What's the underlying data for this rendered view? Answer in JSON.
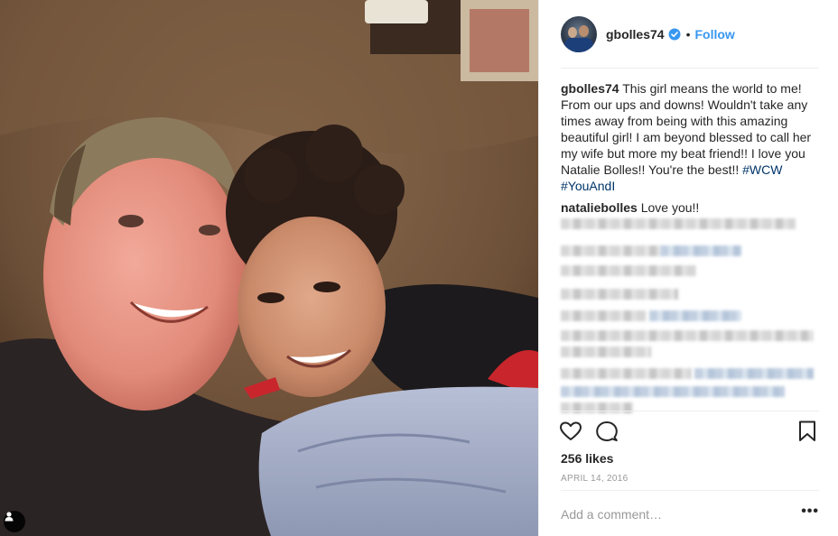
{
  "post": {
    "username": "gbolles74",
    "verified": true,
    "follow_label": "Follow",
    "separator": "•",
    "caption_user": "gbolles74",
    "caption_text": "This girl means the world to me! From our ups and downs! Wouldn't take any times away from being with this amazing beautiful girl! I am beyond blessed to call her my wife but more my beat friend!! I love you Natalie Bolles!! You're the best!! ",
    "hashtags": [
      "#WCW",
      "#YouAndI"
    ],
    "reply_user": "nataliebolles",
    "reply_text": "Love you!!",
    "likes": "256 likes",
    "date": "April 14, 2016",
    "comment_placeholder": "Add a comment…",
    "more_label": "•••"
  },
  "icons": {
    "like": "heart-icon",
    "comment": "comment-bubble-icon",
    "save": "bookmark-icon",
    "tag": "user-tag-icon",
    "verified": "verified-badge-icon",
    "options": "more-options-icon"
  },
  "colors": {
    "accent": "#3897f0",
    "hashtag": "#003569",
    "muted": "#999999",
    "text": "#262626"
  }
}
